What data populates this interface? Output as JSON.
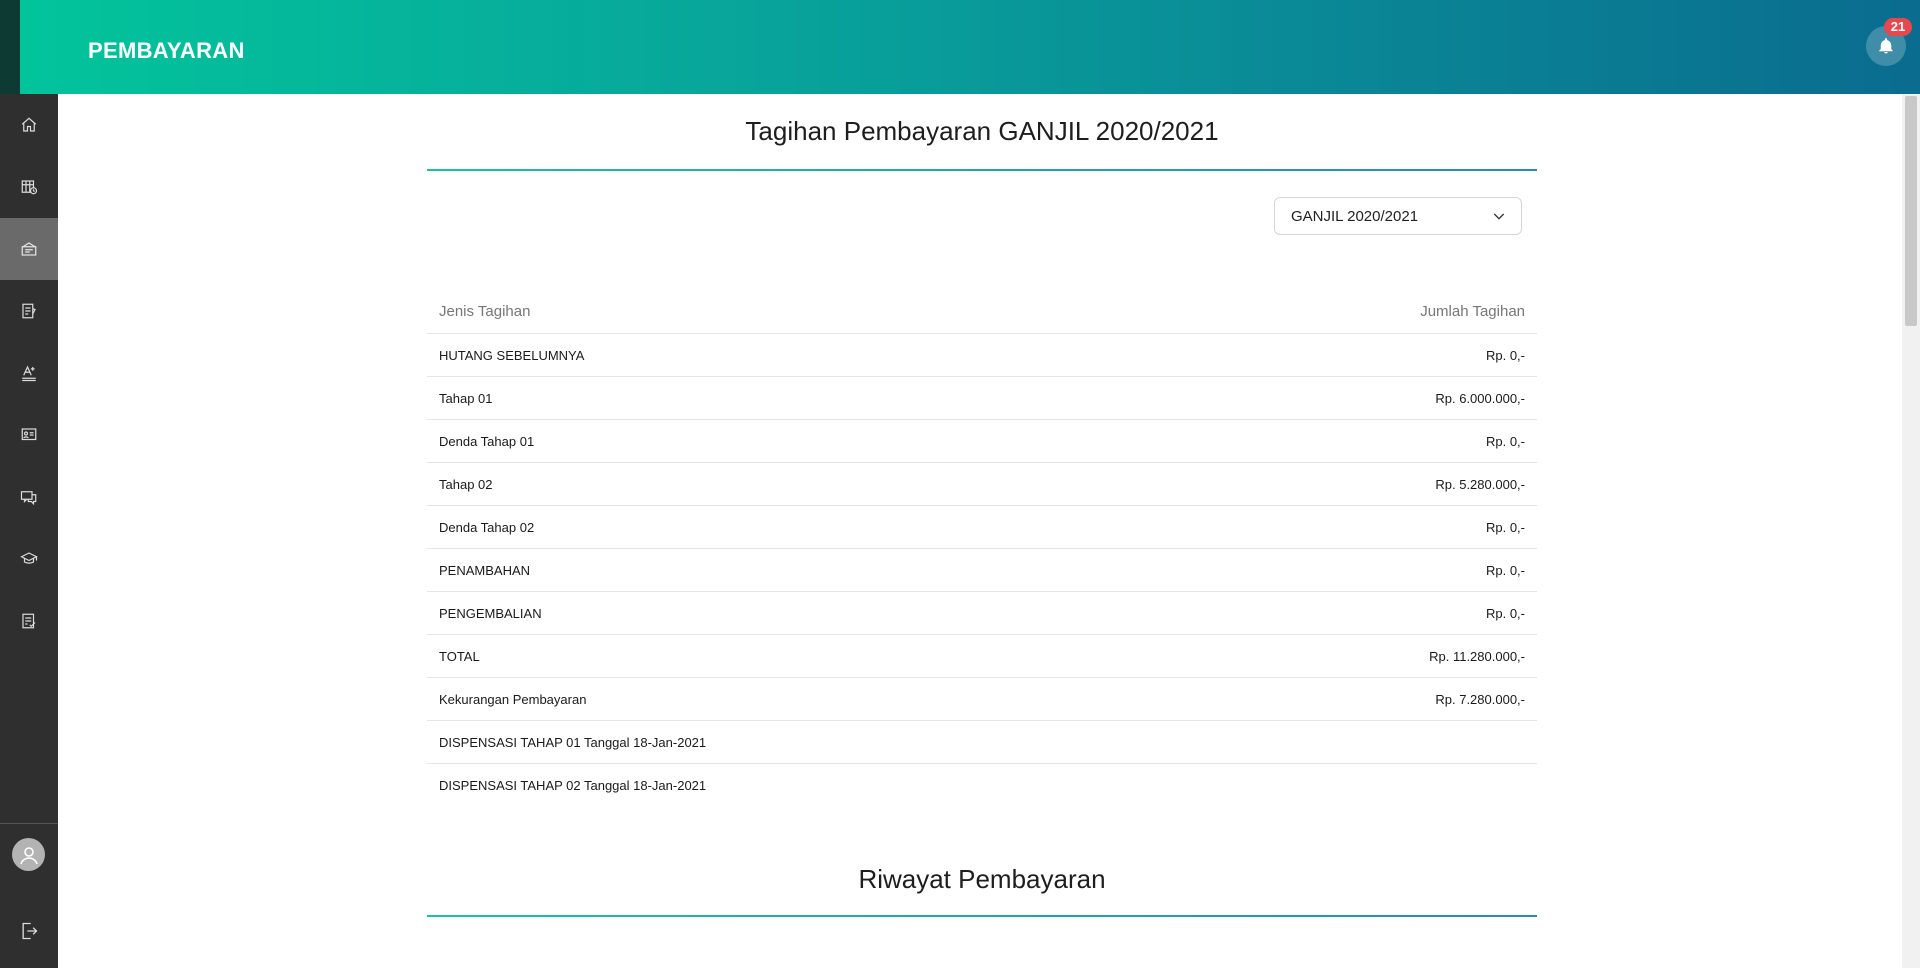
{
  "header": {
    "title": "PEMBAYARAN",
    "notification_count": "21"
  },
  "sidebar": {
    "items": [
      {
        "icon": "home-icon"
      },
      {
        "icon": "calendar-icon"
      },
      {
        "icon": "payment-icon"
      },
      {
        "icon": "document-icon"
      },
      {
        "icon": "grade-icon"
      },
      {
        "icon": "presentation-icon"
      },
      {
        "icon": "chat-icon"
      },
      {
        "icon": "graduation-icon"
      },
      {
        "icon": "checklist-icon"
      }
    ],
    "active_index": 2
  },
  "billing": {
    "title": "Tagihan Pembayaran GANJIL 2020/2021",
    "semester_select": "GANJIL 2020/2021",
    "col_type": "Jenis Tagihan",
    "col_amount": "Jumlah Tagihan",
    "rows": [
      {
        "label": "HUTANG SEBELUMNYA",
        "amount": "Rp. 0,-"
      },
      {
        "label": "Tahap 01",
        "amount": "Rp. 6.000.000,-"
      },
      {
        "label": "Denda Tahap 01",
        "amount": "Rp. 0,-"
      },
      {
        "label": "Tahap 02",
        "amount": "Rp. 5.280.000,-"
      },
      {
        "label": "Denda Tahap 02",
        "amount": "Rp. 0,-"
      },
      {
        "label": "PENAMBAHAN",
        "amount": "Rp. 0,-"
      },
      {
        "label": "PENGEMBALIAN",
        "amount": "Rp. 0,-"
      },
      {
        "label": "TOTAL",
        "amount": "Rp. 11.280.000,-"
      },
      {
        "label": "Kekurangan Pembayaran",
        "amount": "Rp. 7.280.000,-"
      },
      {
        "label": "DISPENSASI TAHAP 01 Tanggal 18-Jan-2021",
        "amount": ""
      },
      {
        "label": "DISPENSASI TAHAP 02 Tanggal 18-Jan-2021",
        "amount": ""
      }
    ]
  },
  "history": {
    "title": "Riwayat Pembayaran"
  },
  "colors": {
    "header_start": "#02c59b",
    "header_end": "#0a6c8f",
    "sidebar_bg": "#2f2f2f",
    "badge": "#e8474d"
  }
}
